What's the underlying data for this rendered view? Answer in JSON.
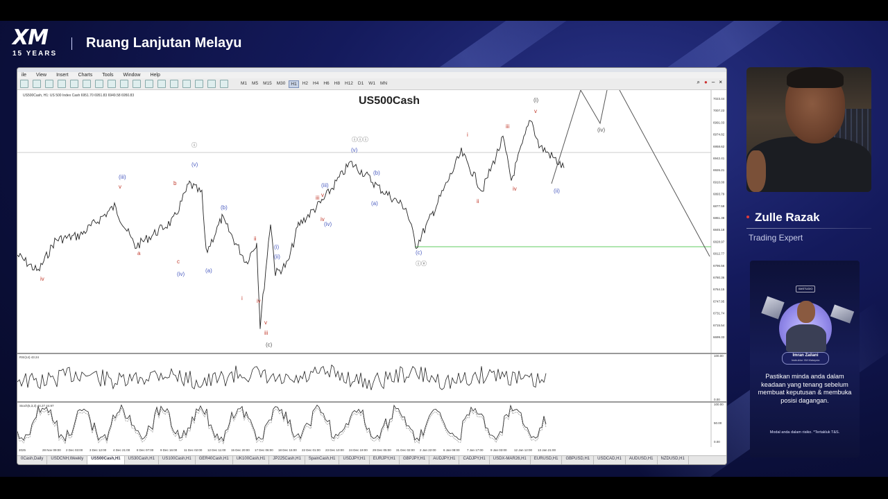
{
  "brand": {
    "logo": "XM",
    "anniversary": "15 YEARS"
  },
  "show_title": "Ruang Lanjutan Melayu",
  "platform": {
    "menu": [
      "ile",
      "View",
      "Insert",
      "Charts",
      "Tools",
      "Window",
      "Help"
    ],
    "timeframes": [
      "M1",
      "M5",
      "M15",
      "M30",
      "H1",
      "H2",
      "H4",
      "H6",
      "H8",
      "H12",
      "D1",
      "W1",
      "MN"
    ],
    "active_timeframe": "H1",
    "chart_info": "US500Cash, H1: US 500 Index Cash 6951.70 6951.83 6949.58 6950.83",
    "symbol": "US500Cash",
    "price_ticks": [
      "7023.44",
      "7007.23",
      "6991.03",
      "6974.82",
      "6958.62",
      "6942.41",
      "6926.21",
      "6910.00",
      "6893.79",
      "6877.59",
      "6861.38",
      "6845.18",
      "6828.97",
      "6812.77",
      "6796.56",
      "6780.36",
      "6764.15",
      "6747.95",
      "6731.74",
      "6715.54",
      "6699.33"
    ],
    "time_ticks": [
      "2025",
      "28 Nov 09:00",
      "2 Dec 03:00",
      "3 Dec 12:00",
      "4 Dec 21:00",
      "8 Dec 07:00",
      "9 Dec 16:00",
      "11 Dec 02:00",
      "12 Dec 11:00",
      "15 Dec 20:00",
      "17 Dec 06:00",
      "18 Dec 15:00",
      "22 Dec 01:00",
      "23 Dec 10:00",
      "24 Dec 19:00",
      "29 Dec 05:00",
      "31 Dec 02:00",
      "2 Jan 22:00",
      "6 Jan 08:00",
      "7 Jan 17:00",
      "9 Jan 03:00",
      "12 Jan 12:00",
      "13 Jan 21:00"
    ],
    "rsi_label": "RSI(14) 43.24",
    "rsi_scale": [
      "100.00",
      "0.00"
    ],
    "stoch_label": "Stoch(5,3,3) 44.27 44.97",
    "stoch_scale": [
      "100.00",
      "50.00",
      "0.00"
    ],
    "wave_labels": [
      {
        "t": "iv",
        "c": "red"
      },
      {
        "t": "(iii)",
        "c": "blue"
      },
      {
        "t": "v",
        "c": "red"
      },
      {
        "t": "a",
        "c": "red"
      },
      {
        "t": "b",
        "c": "red"
      },
      {
        "t": "c",
        "c": "red"
      },
      {
        "t": "(iv)",
        "c": "blue"
      },
      {
        "t": "(v)",
        "c": "blue"
      },
      {
        "t": "ⓘ",
        "c": "gray"
      },
      {
        "t": "(b)",
        "c": "blue"
      },
      {
        "t": "(a)",
        "c": "blue"
      },
      {
        "t": "i",
        "c": "red"
      },
      {
        "t": "ii",
        "c": "red"
      },
      {
        "t": "iii",
        "c": "red"
      },
      {
        "t": "iv",
        "c": "red"
      },
      {
        "t": "v",
        "c": "red"
      },
      {
        "t": "(i)",
        "c": "blue"
      },
      {
        "t": "(ii)",
        "c": "blue"
      },
      {
        "t": "(c)",
        "c": "gray"
      },
      {
        "t": "(iii)",
        "c": "blue"
      },
      {
        "t": "iii",
        "c": "red"
      },
      {
        "t": "v",
        "c": "red"
      },
      {
        "t": "iv",
        "c": "red"
      },
      {
        "t": "(iv)",
        "c": "blue"
      },
      {
        "t": "ⓘⓘⓘ",
        "c": "gray"
      },
      {
        "t": "(v)",
        "c": "blue"
      },
      {
        "t": "(b)",
        "c": "blue"
      },
      {
        "t": "(a)",
        "c": "blue"
      },
      {
        "t": "(c)",
        "c": "blue"
      },
      {
        "t": "ⓘⓥ",
        "c": "gray"
      },
      {
        "t": "i",
        "c": "red"
      },
      {
        "t": "ii",
        "c": "red"
      },
      {
        "t": "iii",
        "c": "red"
      },
      {
        "t": "iv",
        "c": "red"
      },
      {
        "t": "(i)",
        "c": "gray"
      },
      {
        "t": "v",
        "c": "red"
      },
      {
        "t": "(ii)",
        "c": "blue"
      },
      {
        "t": "(iv)",
        "c": "gray"
      }
    ],
    "tabs": [
      "0Cash,Daily",
      "USDCNH,Weekly",
      "US500Cash,H1",
      "US30Cash,H1",
      "US100Cash,H1",
      "GER40Cash,H1",
      "UK100Cash,H1",
      "JP225Cash,H1",
      "SpainCash,H1",
      "USDJPY,H1",
      "EURJPY,H1",
      "GBPJPY,H1",
      "AUDJPY,H1",
      "CADJPY,H1",
      "USDX-MAR26,H1",
      "EURUSD,H1",
      "GBPUSD,H1",
      "USDCAD,H1",
      "AUDUSD,H1",
      "NZDUSD,H1"
    ],
    "active_tab": "US500Cash,H1"
  },
  "presenter": {
    "name": "Zulle Razak",
    "role": "Trading Expert"
  },
  "ad": {
    "brand": "XMSTUDIO",
    "person_name": "Imran Zailani",
    "person_role": "Instruktur XM Malaysia",
    "message": "Pastikan minda anda dalam keadaan yang tenang sebelum membuat keputusan & membuka posisi dagangan.",
    "disclaimer": "Modal anda dalam risiko. *Tertakluk T&S."
  },
  "colors": {
    "bg": "#0b0f3a",
    "accent_red": "#e03a3a",
    "wave_blue": "#4a5cc0",
    "wave_red": "#c0392b",
    "support": "#7fd67f"
  }
}
